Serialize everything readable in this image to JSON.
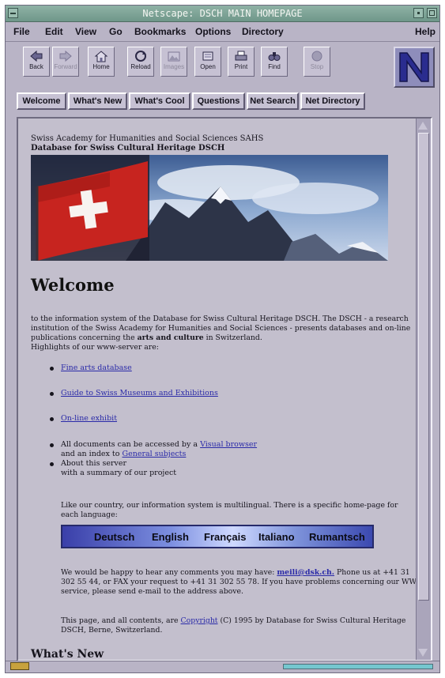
{
  "window": {
    "title": "Netscape: DSCH MAIN HOMEPAGE"
  },
  "menu": [
    "File",
    "Edit",
    "View",
    "Go",
    "Bookmarks",
    "Options",
    "Directory",
    "Help"
  ],
  "toolbar": {
    "back": "Back",
    "forward": "Forward",
    "home": "Home",
    "reload": "Reload",
    "images": "Images",
    "open": "Open",
    "print": "Print",
    "find": "Find",
    "stop": "Stop"
  },
  "directory_buttons": [
    "Welcome",
    "What's New",
    "What's Cool",
    "Questions",
    "Net Search",
    "Net Directory"
  ],
  "page": {
    "org_line1": "Swiss Academy for Humanities and Social Sciences SAHS",
    "org_line2": "Database for Swiss Cultural Heritage DSCH",
    "heading": "Welcome",
    "intro_a": "to the information system of the Database for Swiss Cultural Heritage DSCH. The DSCH - a research institution of the Swiss Academy for Humanities and Social Sciences - presents databases and on-line publications concerning the",
    "intro_bold": "arts and culture",
    "intro_b": "in Switzerland.",
    "intro_c": "Highlights of our www-server are:",
    "link_fine_arts": "Fine arts database",
    "link_museums": "Guide to Swiss Museums and Exhibitions",
    "link_exhibit": "On-line exhibit",
    "docs_prefix": "All documents can be accessed by a",
    "link_visual": "Visual browser",
    "index_prefix": "and an index to",
    "link_general": "General subjects",
    "about_1": "About this server",
    "about_2": "with a summary of our project",
    "multilingual": "Like our country, our information system is multilingual. There is a specific home-page for each language:",
    "languages": [
      "Deutsch",
      "English",
      "Français",
      "Italiano",
      "Rumantsch"
    ],
    "comments_prefix": "We would be happy to hear any comments you may have:",
    "email": "meili@dsk.ch.",
    "comments_suffix": "Phone us at +41 31 302 55 44, or FAX your request to +41 31 302 55 78. If you have problems concerning our WWW service, please send e-mail to the address above.",
    "copyright_prefix": "This page, and all contents, are",
    "copyright_link": "Copyright",
    "copyright_suffix": "(C) 1995 by Database for Swiss Cultural Heritage DSCH, Berne, Switzerland.",
    "whats_new": "What's New"
  },
  "colors": {
    "window_bg": "#b9b4c6",
    "page_bg": "#c3bfcd",
    "link": "#2a2aa8",
    "title_bar": "#7fa698"
  }
}
